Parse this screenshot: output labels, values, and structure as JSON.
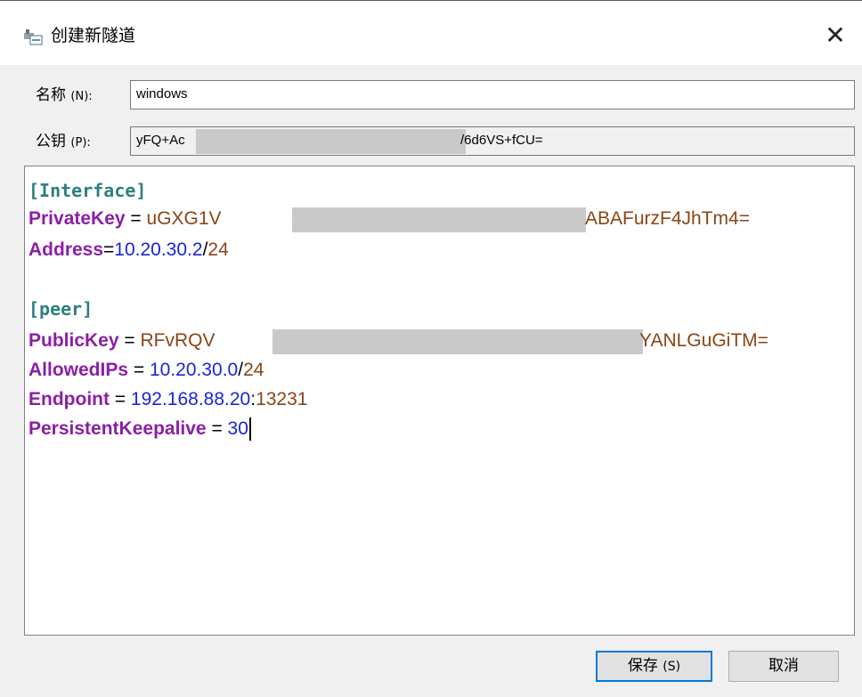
{
  "window": {
    "title": "创建新隧道",
    "close_icon": "close-icon"
  },
  "form": {
    "name_label": "名称",
    "name_shortcut": "(N):",
    "name_value": "windows",
    "pubkey_label": "公钥",
    "pubkey_shortcut": "(P):",
    "pubkey_prefix": "yFQ+Ac",
    "pubkey_suffix": "/6d6VS+fCU="
  },
  "editor": {
    "interface_header": "[Interface]",
    "private_key_name": "PrivateKey",
    "private_key_prefix": "uGXG1V",
    "private_key_suffix": "ABAFurzF4JhTm4=",
    "address_name": "Address",
    "address_ip": "10.20.30.2",
    "address_slash": "/",
    "address_mask": "24",
    "peer_header": "[peer]",
    "public_key_name": "PublicKey",
    "public_key_prefix": "RFvRQV",
    "public_key_suffix": "YANLGuGiTM=",
    "allowed_ips_name": "AllowedIPs",
    "allowed_ips_ip": "10.20.30.0",
    "allowed_ips_slash": "/",
    "allowed_ips_mask": "24",
    "endpoint_name": "Endpoint",
    "endpoint_host": "192.168.88.20",
    "endpoint_colon": ":",
    "endpoint_port": "13231",
    "keepalive_name": "PersistentKeepalive",
    "keepalive_value": "30",
    "eq": "=",
    "eq_spaced": " = "
  },
  "buttons": {
    "save_label": "保存",
    "save_shortcut": "(S)",
    "cancel_label": "取消"
  },
  "colors": {
    "section": "#2e7f80",
    "key": "#8b1fa4",
    "value": "#8a4514",
    "number": "#1a24d6",
    "focus_border": "#0078d7"
  }
}
